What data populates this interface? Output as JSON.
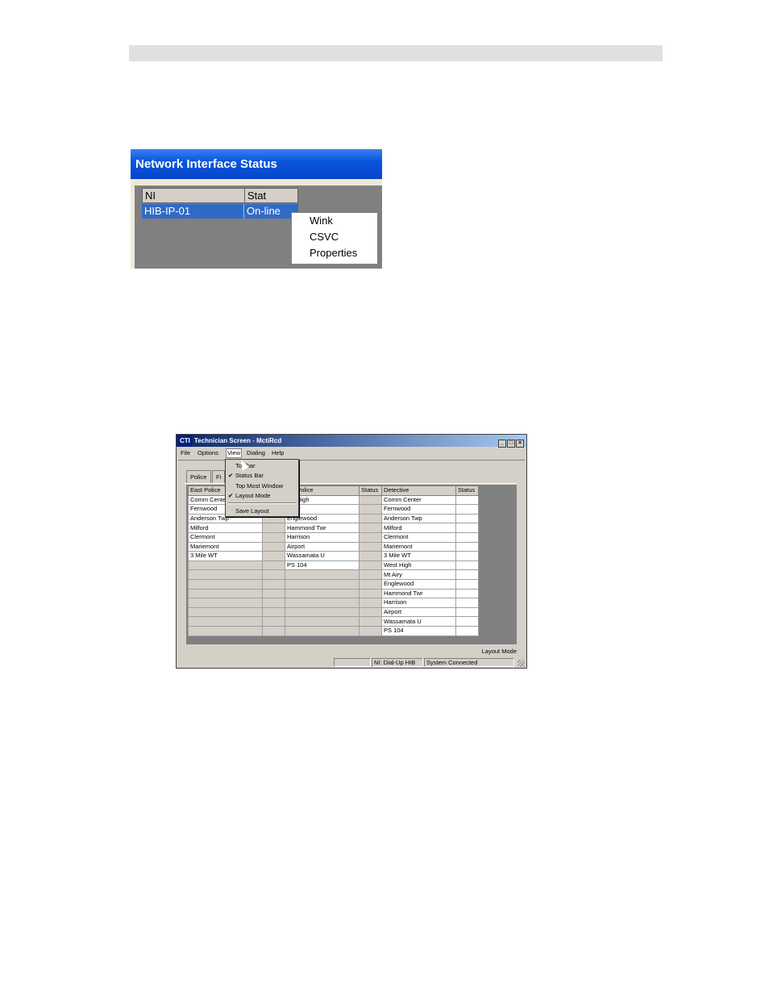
{
  "ni_window": {
    "title": "Network Interface Status",
    "columns": [
      "NI",
      "Stat"
    ],
    "row": {
      "ni": "HIB-IP-01",
      "stat": "On-line"
    },
    "context_menu": [
      "Wink",
      "CSVC",
      "Properties"
    ]
  },
  "tech_window": {
    "title_icon": "CTI",
    "title": "Technician Screen - MctiRcd",
    "menubar": [
      "File",
      "Options",
      "View",
      "Dialing",
      "Help"
    ],
    "view_menu": {
      "toolbar": "Toolbar",
      "status_bar": "Status Bar",
      "top_most": "Top Most Window",
      "layout_mode": "Layout Mode",
      "save_layout": "Save Layout",
      "check": "✔"
    },
    "tabs": [
      "Police",
      "Fi"
    ],
    "columns": [
      "East Police",
      "",
      "est Police",
      "Status",
      "Detective",
      "Status"
    ],
    "rows": [
      [
        "Comm Cente",
        "",
        "est High",
        "",
        "Comm Center",
        ""
      ],
      [
        "Fernwood",
        "",
        "t Airy",
        "",
        "Fernwood",
        ""
      ],
      [
        "Anderson Twp",
        "",
        "Englewood",
        "",
        "Anderson Twp",
        ""
      ],
      [
        "Milford",
        "",
        "Hammond Twr",
        "",
        "Milford",
        ""
      ],
      [
        "Clermont",
        "",
        "Harrison",
        "",
        "Clermont",
        ""
      ],
      [
        "Mariemont",
        "",
        "Airport",
        "",
        "Mariemont",
        ""
      ],
      [
        "3 Mile WT",
        "",
        "Wassamata U",
        "",
        "3 Mile WT",
        ""
      ],
      [
        "",
        "",
        "PS 104",
        "",
        "West High",
        ""
      ],
      [
        "",
        "",
        "",
        "",
        "Mt Airy",
        ""
      ],
      [
        "",
        "",
        "",
        "",
        "Englewood",
        ""
      ],
      [
        "",
        "",
        "",
        "",
        "Hammond Twr",
        ""
      ],
      [
        "",
        "",
        "",
        "",
        "Harrison",
        ""
      ],
      [
        "",
        "",
        "",
        "",
        "Airport",
        ""
      ],
      [
        "",
        "",
        "",
        "",
        "Wassamata U",
        ""
      ],
      [
        "",
        "",
        "",
        "",
        "PS 104",
        ""
      ]
    ],
    "layout_mode_label": "Layout Mode",
    "status_bar": {
      "ni": "NI: Dial-Up HIB",
      "connection": "System Connected"
    }
  }
}
